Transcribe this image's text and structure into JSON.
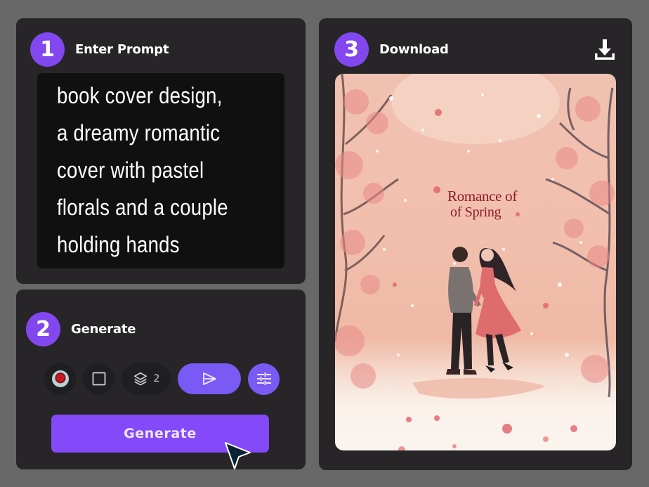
{
  "steps": [
    {
      "number": "1",
      "title": "Enter Prompt"
    },
    {
      "number": "2",
      "title": "Generate"
    },
    {
      "number": "3",
      "title": "Download"
    }
  ],
  "prompt": {
    "lines": [
      "book cover design,",
      "a dreamy romantic",
      "cover with pastel",
      "florals and a couple",
      "holding hands"
    ],
    "text": "book cover design,\na dreamy romantic\ncover with pastel\nflorals and a couple\nholding hands"
  },
  "toolbar": {
    "reference_image_icon": "rose-thumbnail",
    "aspect_ratio_icon": "square-icon",
    "layers_icon": "layers-icon",
    "layers_count": "2",
    "send_icon": "send-icon",
    "settings_icon": "sliders-icon"
  },
  "generate_button": {
    "label": "Generate"
  },
  "download": {
    "icon": "download-icon"
  },
  "cover": {
    "title_line1": "Romance of",
    "title_line2": "of Spring"
  },
  "colors": {
    "accent": "#8347ef",
    "button": "#8449f9",
    "pill": "#7a5af5",
    "panel": "#272527",
    "background": "#686868",
    "prompt_bg": "#111010",
    "cover_title": "#8a1c2e"
  }
}
